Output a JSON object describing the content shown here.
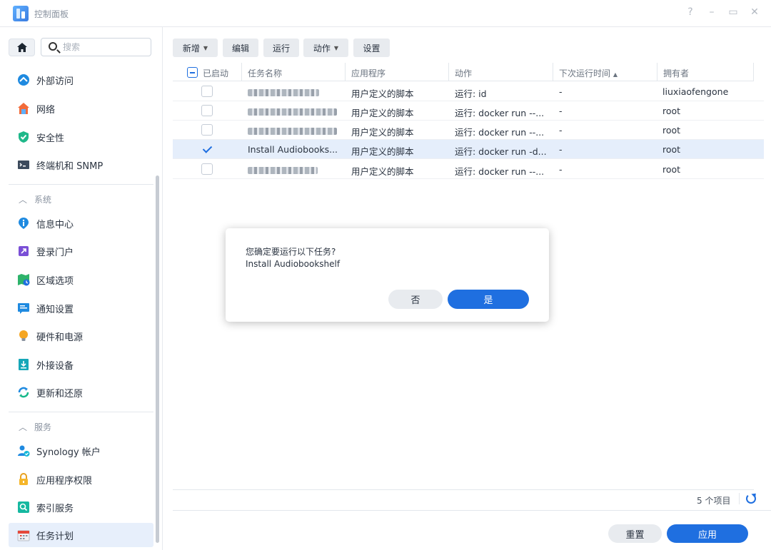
{
  "window": {
    "title": "控制面板",
    "controls": [
      "?",
      "–",
      "▭",
      "✕"
    ]
  },
  "sidebar": {
    "search_placeholder": "搜索",
    "items_top": [
      {
        "label": "外部访问",
        "icon": "external-access-icon"
      },
      {
        "label": "网络",
        "icon": "network-icon"
      },
      {
        "label": "安全性",
        "icon": "shield-icon"
      },
      {
        "label": "终端机和 SNMP",
        "icon": "terminal-icon"
      }
    ],
    "section_system": "系统",
    "items_system": [
      {
        "label": "信息中心",
        "icon": "info-icon"
      },
      {
        "label": "登录门户",
        "icon": "login-portal-icon"
      },
      {
        "label": "区域选项",
        "icon": "region-icon"
      },
      {
        "label": "通知设置",
        "icon": "notification-icon"
      },
      {
        "label": "硬件和电源",
        "icon": "bulb-icon"
      },
      {
        "label": "外接设备",
        "icon": "external-device-icon"
      },
      {
        "label": "更新和还原",
        "icon": "update-icon"
      }
    ],
    "section_services": "服务",
    "items_services": [
      {
        "label": "Synology 帐户",
        "icon": "account-icon"
      },
      {
        "label": "应用程序权限",
        "icon": "lock-icon"
      },
      {
        "label": "索引服务",
        "icon": "index-icon"
      },
      {
        "label": "任务计划",
        "icon": "calendar-icon"
      }
    ]
  },
  "toolbar": {
    "add": "新增",
    "edit": "编辑",
    "run": "运行",
    "action": "动作",
    "settings": "设置"
  },
  "grid": {
    "columns": [
      "已启动",
      "任务名称",
      "应用程序",
      "动作",
      "下次运行时间",
      "拥有者"
    ],
    "sort_indicator": "▲",
    "rows": [
      {
        "enabled": false,
        "name": "",
        "app": "用户定义的脚本",
        "action": "运行: id",
        "next": "-",
        "owner": "liuxiaofengone"
      },
      {
        "enabled": false,
        "name": "",
        "app": "用户定义的脚本",
        "action": "运行: docker run --...",
        "next": "-",
        "owner": "root"
      },
      {
        "enabled": false,
        "name": "",
        "app": "用户定义的脚本",
        "action": "运行: docker run --...",
        "next": "-",
        "owner": "root"
      },
      {
        "enabled": true,
        "name": "Install Audiobooks...",
        "app": "用户定义的脚本",
        "action": "运行: docker run -d...",
        "next": "-",
        "owner": "root"
      },
      {
        "enabled": false,
        "name": "",
        "app": "用户定义的脚本",
        "action": "运行: docker run --...",
        "next": "-",
        "owner": "root"
      }
    ]
  },
  "footer": {
    "count": "5 个项目",
    "reset": "重置",
    "apply": "应用"
  },
  "dialog": {
    "question": "您确定要运行以下任务?",
    "task": "Install Audiobookshelf",
    "no": "否",
    "yes": "是"
  },
  "colors": {
    "accent": "#1f6fe0",
    "selected_row": "#e5eefb"
  }
}
